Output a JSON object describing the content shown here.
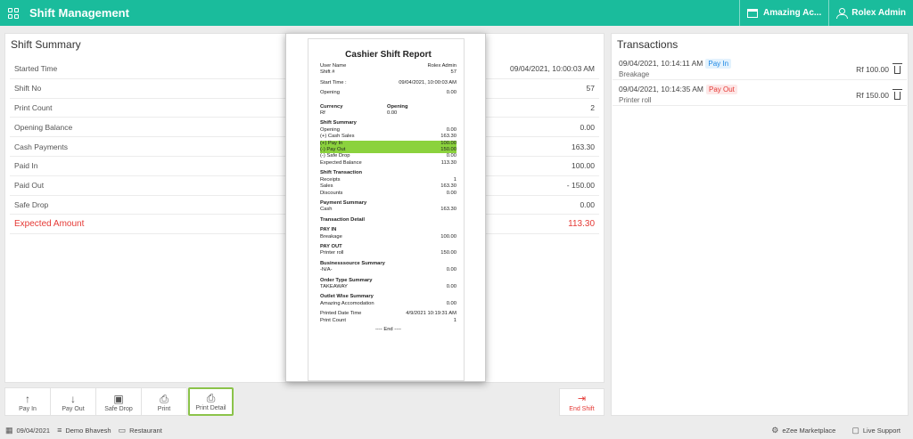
{
  "header": {
    "title": "Shift Management",
    "property": "Amazing Ac...",
    "user": "Rolex Admin"
  },
  "summary": {
    "title": "Shift Summary",
    "rows": [
      {
        "label": "Started Time",
        "value": "09/04/2021, 10:00:03 AM"
      },
      {
        "label": "Shift No",
        "value": "57"
      },
      {
        "label": "Print Count",
        "value": "2"
      },
      {
        "label": "Opening Balance",
        "value": "0.00"
      },
      {
        "label": "Cash Payments",
        "value": "163.30"
      },
      {
        "label": "Paid In",
        "value": "100.00"
      },
      {
        "label": "Paid Out",
        "value": "- 150.00"
      },
      {
        "label": "Safe Drop",
        "value": "0.00"
      }
    ],
    "expected_label": "Expected Amount",
    "expected_value": "113.30"
  },
  "transactions": {
    "title": "Transactions",
    "items": [
      {
        "datetime": "09/04/2021, 10:14:11 AM",
        "type": "Pay In",
        "note": "Breakage",
        "amount": "Rf 100.00"
      },
      {
        "datetime": "09/04/2021, 10:14:35 AM",
        "type": "Pay Out",
        "note": "Printer roll",
        "amount": "Rf 150.00"
      }
    ]
  },
  "toolbar": {
    "pay_in": "Pay In",
    "pay_out": "Pay Out",
    "safe_drop": "Safe Drop",
    "print": "Print",
    "print_detail": "Print Detail",
    "end_shift": "End Shift"
  },
  "statusbar": {
    "date": "09/04/2021",
    "user": "Demo Bhavesh",
    "outlet": "Restaurant",
    "marketplace": "eZee Marketplace",
    "support": "Live Support"
  },
  "receipt": {
    "title": "Cashier Shift Report",
    "user_name_label": "User Name",
    "user_name": "Rolex Admin",
    "shift_label": "Shift #",
    "shift": "57",
    "start_time_label": "Start Time :",
    "start_time": "09/04/2021, 10:00:03 AM",
    "opening_label": "Opening",
    "opening": "0.00",
    "currency_label": "Currency",
    "opening_col_label": "Opening",
    "currency": "Rf",
    "currency_opening": "0.00",
    "shift_summary_label": "Shift Summary",
    "ss_opening_label": "Opening",
    "ss_opening": "0.00",
    "cash_sales_label": "(+) Cash Sales",
    "cash_sales": "163.30",
    "pay_in_label": "(+) Pay In",
    "pay_in": "100.00",
    "pay_out_label": "(-) Pay Out",
    "pay_out": "150.00",
    "safe_drop_label": "(-) Safe Drop",
    "safe_drop": "0.00",
    "expected_label": "Expected Balance",
    "expected": "113.30",
    "shift_txn_label": "Shift Transaction",
    "receipts_label": "Receipts",
    "receipts": "1",
    "sales_label": "Sales",
    "sales": "163.30",
    "discounts_label": "Discounts",
    "discounts": "0.00",
    "payment_summary_label": "Payment Summary",
    "cash_label": "Cash",
    "cash": "163.30",
    "txn_detail_label": "Transaction Detail",
    "pay_in_head": "PAY IN",
    "breakage_label": "Breakage",
    "breakage": "100.00",
    "pay_out_head": "PAY OUT",
    "printer_roll_label": "Printer roll",
    "printer_roll": "150.00",
    "bsource_label": "Businesssource Summary",
    "na_label": "-N/A-",
    "na": "0.00",
    "order_type_label": "Order Type Summary",
    "takeaway_label": "TAKEAWAY",
    "takeaway": "0.00",
    "outlet_wise_label": "Outlet Wise Summary",
    "amazing_label": "Amazing Accomodation",
    "amazing": "0.00",
    "printed_label": "Printed Date Time",
    "printed": "4/9/2021 10:19:31 AM",
    "print_count_label": "Print Count",
    "print_count": "1",
    "end_label": "---- End ----"
  }
}
